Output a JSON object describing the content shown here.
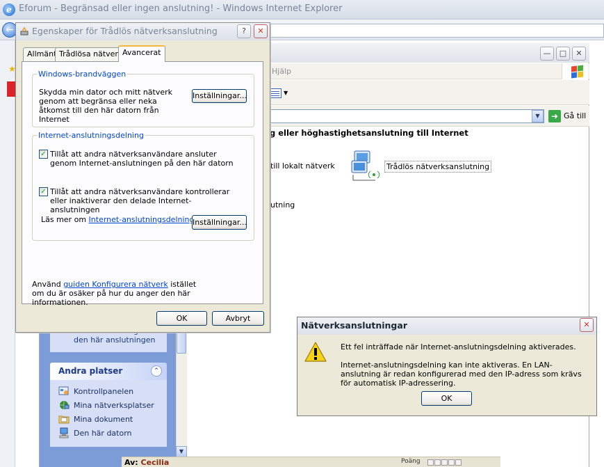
{
  "ie": {
    "title": "Eforum - Begränsad eller ingen anslutning! - Windows Internet Explorer",
    "forum_author_label": "Av:",
    "forum_author_name": "Cecilia",
    "forum_points_label": "Poäng"
  },
  "network_window": {
    "menu_help": "Hjälp",
    "go_to_label": "Gå till",
    "section_header": "g eller höghastighetsanslutning till Internet",
    "lan_item_label": "till lokalt nätverk",
    "wireless_item_label": "Trådlös nätverksanslutning",
    "partial_item_label": "utning",
    "task_item_partial": "Ändra inställningar för den här anslutningen",
    "other_places": {
      "title": "Andra platser",
      "items": [
        {
          "label": "Kontrollpanelen",
          "icon": "control-panel-icon"
        },
        {
          "label": "Mina nätverksplatser",
          "icon": "network-places-icon"
        },
        {
          "label": "Mina dokument",
          "icon": "documents-folder-icon"
        },
        {
          "label": "Den här datorn",
          "icon": "my-computer-icon"
        }
      ]
    }
  },
  "properties_dialog": {
    "title": "Egenskaper för Trådlös nätverksanslutning",
    "tabs": [
      "Allmänt",
      "Trådlösa nätverk",
      "Avancerat"
    ],
    "active_tab": "Avancerat",
    "firewall": {
      "legend": "Windows-brandväggen",
      "description": "Skydda min dator och mitt nätverk genom att begränsa eller neka åtkomst till den här datorn från Internet",
      "settings_button": "Inställningar..."
    },
    "ics": {
      "legend": "Internet-anslutningsdelning",
      "checkbox1_label": "Tillåt att andra nätverksanvändare ansluter genom Internet-anslutningen på den här datorn",
      "checkbox1_checked": true,
      "checkbox2_label": "Tillåt att andra nätverksanvändare kontrollerar eller inaktiverar den delade Internet-anslutningen",
      "checkbox2_checked": true,
      "learn_more_prefix": "Läs mer om",
      "learn_more_link": "Internet-anslutningsdelning",
      "learn_more_suffix": ".",
      "settings_button": "Inställningar..."
    },
    "footer_prefix": "Använd",
    "footer_link": "guiden Konfigurera nätverk",
    "footer_suffix": "istället om du är osäker på hur du anger den här informationen.",
    "ok_button": "OK",
    "cancel_button": "Avbryt"
  },
  "error_dialog": {
    "title": "Nätverksanslutningar",
    "message_line1": "Ett fel inträffade när Internet-anslutningsdelning aktiverades.",
    "message_detail": "Internet-anslutningsdelning kan inte aktiveras. En LAN-anslutning är redan konfigurerad med den IP-adress som krävs för automatisk IP-adressering.",
    "ok_button": "OK",
    "icon": "warning-icon"
  }
}
